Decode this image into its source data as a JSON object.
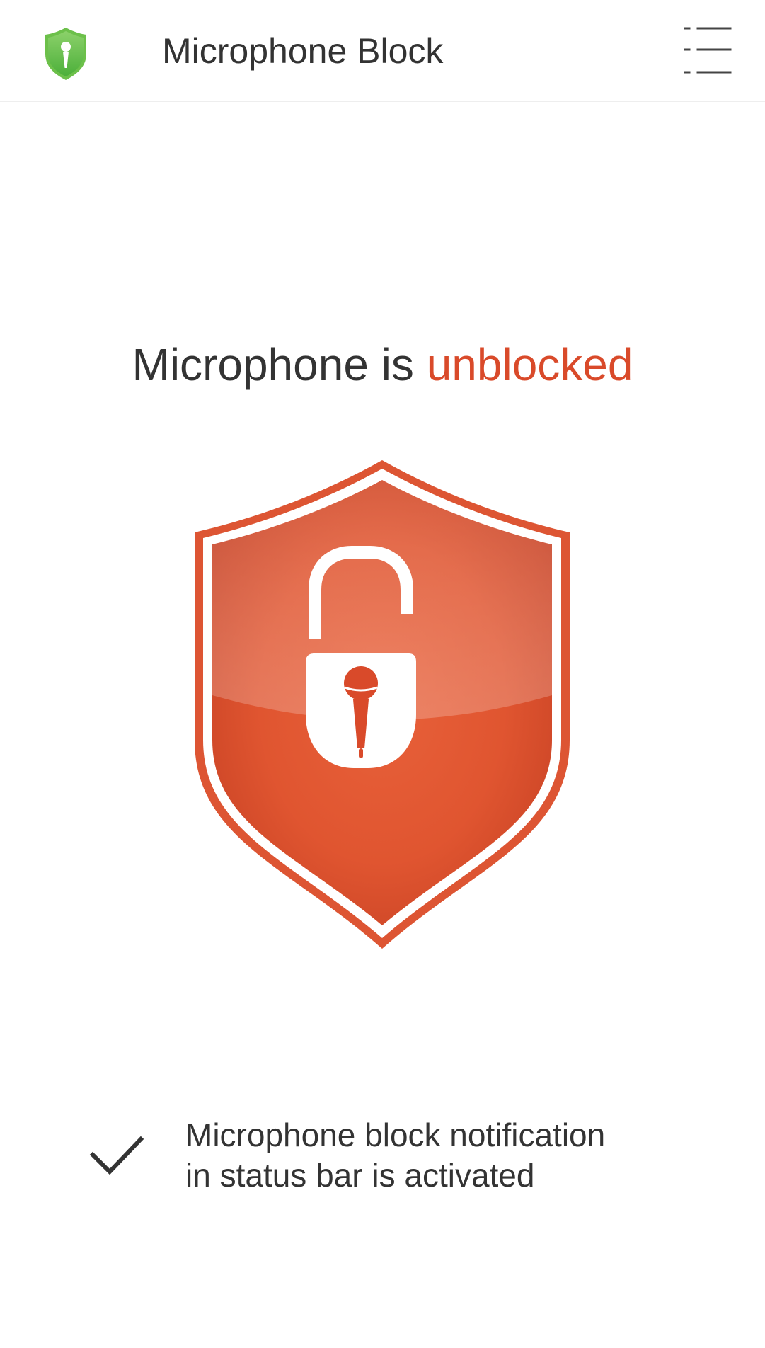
{
  "app_bar": {
    "title": "Microphone Block",
    "logo_icon": "green-shield-microphone-icon",
    "menu_icon": "list-menu-icon"
  },
  "status": {
    "prefix": "Microphone is ",
    "state": "unblocked",
    "state_color": "#d94a2a"
  },
  "shield": {
    "icon": "unlocked-padlock-microphone-shield-icon",
    "color": "#dd5533"
  },
  "notification": {
    "icon": "checkmark-icon",
    "line1": "Microphone block notification",
    "line2": "in status bar is activated"
  }
}
